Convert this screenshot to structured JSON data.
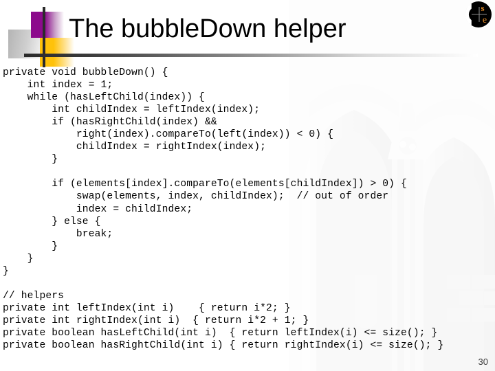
{
  "slide": {
    "title": "The bubbleDown helper",
    "page_number": "30"
  },
  "logo": {
    "name": "cse-logo",
    "letter_s": "s",
    "letter_e": "e",
    "colors": {
      "disc": "#000000",
      "letters": "#e08a28",
      "crosshair": "#7a7a7a"
    }
  },
  "decoration": {
    "colors": {
      "purple": "#8c0a8c",
      "yellow": "#ffc20a",
      "gray": "#b4b4b4",
      "rule": "#2b2b2b"
    }
  },
  "code": {
    "language": "java",
    "lines": [
      "private void bubbleDown() {",
      "    int index = 1;",
      "    while (hasLeftChild(index)) {",
      "        int childIndex = leftIndex(index);",
      "        if (hasRightChild(index) &&",
      "            right(index).compareTo(left(index)) < 0) {",
      "            childIndex = rightIndex(index);",
      "        }",
      "",
      "        if (elements[index].compareTo(elements[childIndex]) > 0) {",
      "            swap(elements, index, childIndex);  // out of order",
      "            index = childIndex;",
      "        } else {",
      "            break;",
      "        }",
      "    }",
      "}",
      "",
      "// helpers",
      "private int leftIndex(int i)    { return i*2; }",
      "private int rightIndex(int i)  { return i*2 + 1; }",
      "private boolean hasLeftChild(int i)  { return leftIndex(i) <= size(); }",
      "private boolean hasRightChild(int i) { return rightIndex(i) <= size(); }"
    ]
  }
}
